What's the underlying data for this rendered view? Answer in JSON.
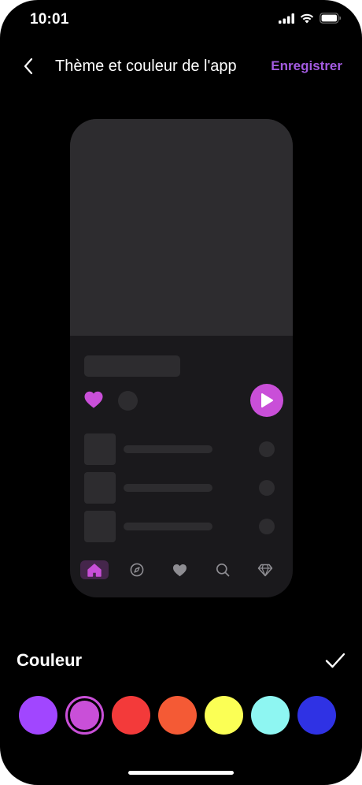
{
  "status_bar": {
    "time": "10:01",
    "icons": [
      "signal-icon",
      "wifi-icon",
      "battery-icon"
    ]
  },
  "header": {
    "back_icon": "chevron-left-icon",
    "title": "Thème et couleur de l'app",
    "save_label": "Enregistrer"
  },
  "accent_color": "#c94fd8",
  "save_color": "#a35be0",
  "preview": {
    "nav_icons": [
      "home-icon",
      "compass-icon",
      "heart-icon",
      "search-icon",
      "diamond-icon"
    ],
    "selected_nav": "home-icon"
  },
  "color_section": {
    "label": "Couleur",
    "confirm_icon": "check-icon",
    "swatches": [
      {
        "name": "violet",
        "color": "#a146ff",
        "selected": false
      },
      {
        "name": "magenta",
        "color": "#c94fd8",
        "selected": true
      },
      {
        "name": "red",
        "color": "#f33a3a",
        "selected": false
      },
      {
        "name": "orange",
        "color": "#f45a35",
        "selected": false
      },
      {
        "name": "yellow",
        "color": "#fbff55",
        "selected": false
      },
      {
        "name": "cyan",
        "color": "#8ef6f2",
        "selected": false
      },
      {
        "name": "blue",
        "color": "#2f32e4",
        "selected": false
      }
    ]
  }
}
